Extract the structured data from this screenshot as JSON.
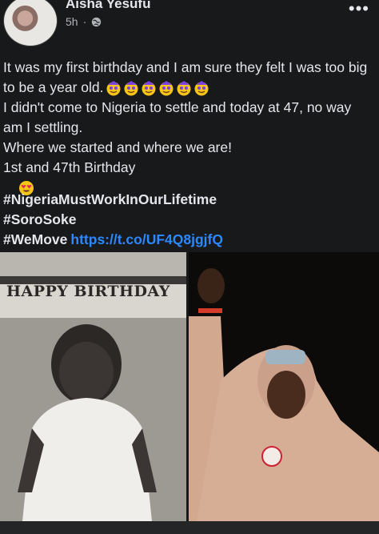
{
  "post": {
    "author": "Aisha Yesufu",
    "time": "5h",
    "meta_separator": "·",
    "privacy_icon": "globe-icon",
    "more_icon": "more-options-icon",
    "more_label": "•••",
    "lines": [
      "It was my first birthday and I am sure they felt I was too big to be a year old.",
      "I didn't come to Nigeria to settle and today at 47, no way am I settling.",
      "Where we started and where we are!",
      "1st and 47th Birthday"
    ],
    "hashtags": [
      "#NigeriaMustWorkInOurLifetime",
      "#SoroSoke",
      "#WeMove"
    ],
    "link": "https://t.co/UF4Q8jgjfQ"
  },
  "photos": {
    "left_banner": "HAPPY BIRTHDAY"
  },
  "colors": {
    "background": "#18191a",
    "text": "#e4e6eb",
    "link": "#2d88ff",
    "meta": "#b0b3b8"
  }
}
